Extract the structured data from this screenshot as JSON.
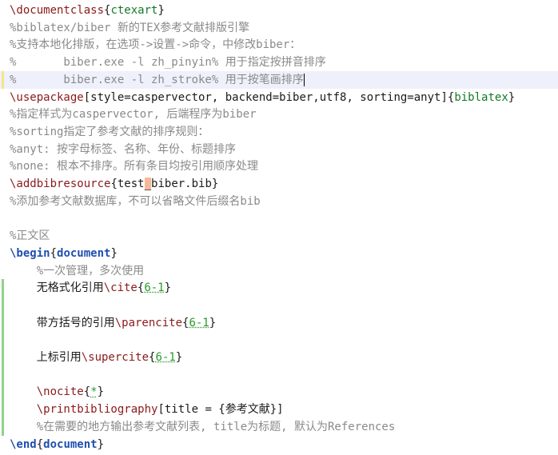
{
  "editor": {
    "lines": [
      {
        "gutter": "",
        "current": false,
        "tokens": [
          {
            "t": "\\documentclass",
            "c": "cmd"
          },
          {
            "t": "{",
            "c": "brace"
          },
          {
            "t": "ctexart",
            "c": "arg"
          },
          {
            "t": "}",
            "c": "brace"
          }
        ]
      },
      {
        "gutter": "",
        "current": false,
        "tokens": [
          {
            "t": "%biblatex/biber 新的TEX参考文献排版引擎",
            "c": "comment"
          }
        ]
      },
      {
        "gutter": "",
        "current": false,
        "tokens": [
          {
            "t": "%支持本地化排版，在选项->设置->命令，中修改biber：",
            "c": "comment"
          }
        ]
      },
      {
        "gutter": "",
        "current": false,
        "tokens": [
          {
            "t": "%       biber.exe -l zh_pinyin% 用于指定按拼音排序",
            "c": "comment"
          }
        ]
      },
      {
        "gutter": "yellow",
        "current": true,
        "caret": true,
        "tokens": [
          {
            "t": "%       biber.exe -l zh_stroke% 用于按笔画排序",
            "c": "comment"
          }
        ]
      },
      {
        "gutter": "",
        "current": false,
        "tokens": [
          {
            "t": "\\usepackage",
            "c": "cmd"
          },
          {
            "t": "[style=caspervector, backend=biber,utf8, sorting=anyt]",
            "c": "text"
          },
          {
            "t": "{",
            "c": "brace"
          },
          {
            "t": "biblatex",
            "c": "arg"
          },
          {
            "t": "}",
            "c": "brace"
          }
        ]
      },
      {
        "gutter": "",
        "current": false,
        "tokens": [
          {
            "t": "%指定样式为caspervector, 后端程序为biber",
            "c": "comment"
          }
        ]
      },
      {
        "gutter": "",
        "current": false,
        "tokens": [
          {
            "t": "%sorting指定了参考文献的排序规则：",
            "c": "comment"
          }
        ]
      },
      {
        "gutter": "",
        "current": false,
        "tokens": [
          {
            "t": "%anyt: 按字母标签、名称、年份、标题排序",
            "c": "comment"
          }
        ]
      },
      {
        "gutter": "",
        "current": false,
        "tokens": [
          {
            "t": "%none: 根本不排序。所有条目均按引用顺序处理",
            "c": "comment"
          }
        ]
      },
      {
        "gutter": "",
        "current": false,
        "tokens": [
          {
            "t": "\\addbibresource",
            "c": "cmd"
          },
          {
            "t": "{",
            "c": "brace"
          },
          {
            "t": "test",
            "c": "text"
          },
          {
            "t": "_",
            "c": "err"
          },
          {
            "t": "biber.bib",
            "c": "text"
          },
          {
            "t": "}",
            "c": "brace"
          }
        ]
      },
      {
        "gutter": "",
        "current": false,
        "tokens": [
          {
            "t": "%添加参考文献数据库，不可以省略文件后缀名bib",
            "c": "comment"
          }
        ]
      },
      {
        "gutter": "",
        "current": false,
        "tokens": []
      },
      {
        "gutter": "",
        "current": false,
        "tokens": [
          {
            "t": "%正文区",
            "c": "comment"
          }
        ]
      },
      {
        "gutter": "",
        "current": false,
        "tokens": [
          {
            "t": "\\begin",
            "c": "env"
          },
          {
            "t": "{",
            "c": "brace"
          },
          {
            "t": "document",
            "c": "env"
          },
          {
            "t": "}",
            "c": "brace"
          }
        ]
      },
      {
        "gutter": "",
        "current": false,
        "tokens": [
          {
            "t": "    %一次管理，多次使用",
            "c": "comment"
          }
        ]
      },
      {
        "gutter": "green",
        "current": false,
        "tokens": [
          {
            "t": "    无格式化引用",
            "c": "text"
          },
          {
            "t": "\\cite",
            "c": "cmd"
          },
          {
            "t": "{",
            "c": "brace"
          },
          {
            "t": "6-1",
            "c": "label"
          },
          {
            "t": "}",
            "c": "brace"
          }
        ]
      },
      {
        "gutter": "green",
        "current": false,
        "tokens": []
      },
      {
        "gutter": "green",
        "current": false,
        "tokens": [
          {
            "t": "    带方括号的引用",
            "c": "text"
          },
          {
            "t": "\\parencite",
            "c": "cmd"
          },
          {
            "t": "{",
            "c": "brace"
          },
          {
            "t": "6-1",
            "c": "label"
          },
          {
            "t": "}",
            "c": "brace"
          }
        ]
      },
      {
        "gutter": "green",
        "current": false,
        "tokens": []
      },
      {
        "gutter": "green",
        "current": false,
        "tokens": [
          {
            "t": "    上标引用",
            "c": "text"
          },
          {
            "t": "\\supercite",
            "c": "cmd"
          },
          {
            "t": "{",
            "c": "brace"
          },
          {
            "t": "6-1",
            "c": "label"
          },
          {
            "t": "}",
            "c": "brace"
          }
        ]
      },
      {
        "gutter": "green",
        "current": false,
        "tokens": []
      },
      {
        "gutter": "green",
        "current": false,
        "tokens": [
          {
            "t": "    \\nocite",
            "c": "cmd"
          },
          {
            "t": "{",
            "c": "brace"
          },
          {
            "t": "*",
            "c": "label"
          },
          {
            "t": "}",
            "c": "brace"
          }
        ]
      },
      {
        "gutter": "green",
        "current": false,
        "tokens": [
          {
            "t": "    \\printbibliography",
            "c": "cmd"
          },
          {
            "t": "[title = ",
            "c": "text"
          },
          {
            "t": "{",
            "c": "brace"
          },
          {
            "t": "参考文献",
            "c": "text"
          },
          {
            "t": "}",
            "c": "brace"
          },
          {
            "t": "]",
            "c": "text"
          }
        ]
      },
      {
        "gutter": "green",
        "current": false,
        "tokens": [
          {
            "t": "    %在需要的地方输出参考文献列表, title为标题, 默认为References",
            "c": "comment"
          }
        ]
      },
      {
        "gutter": "",
        "current": false,
        "tokens": [
          {
            "t": "\\end",
            "c": "env"
          },
          {
            "t": "{",
            "c": "brace"
          },
          {
            "t": "document",
            "c": "env"
          },
          {
            "t": "}",
            "c": "brace"
          }
        ]
      }
    ]
  }
}
